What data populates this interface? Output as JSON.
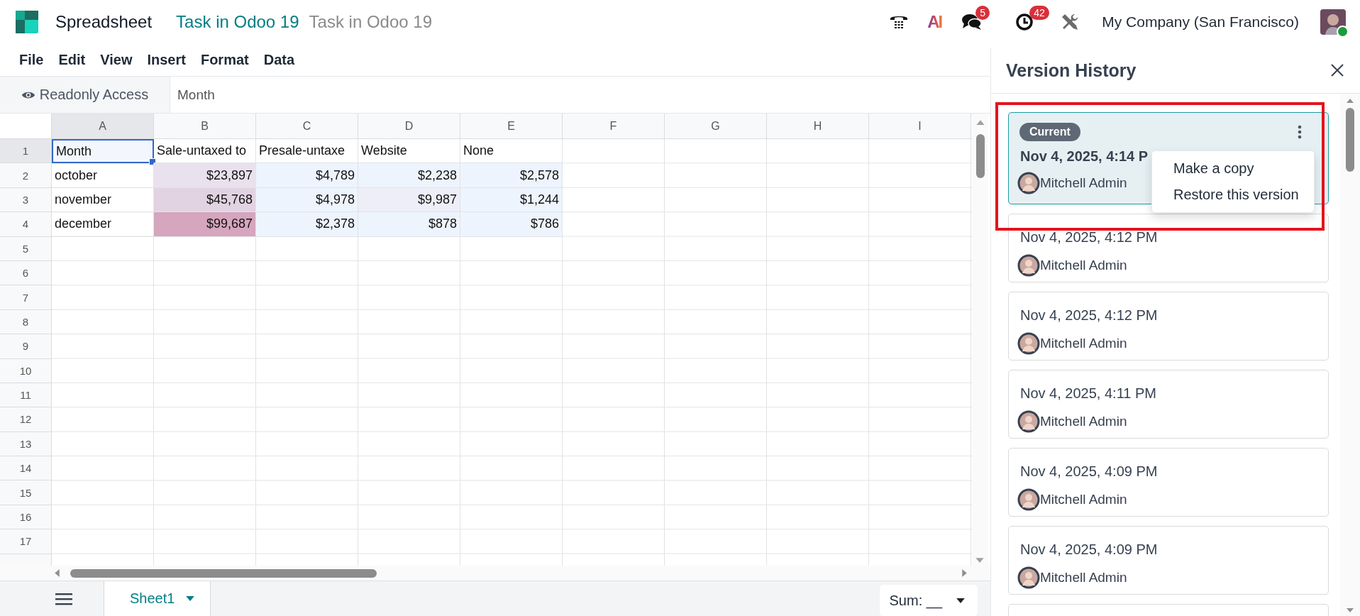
{
  "app": {
    "title": "Spreadsheet",
    "breadcrumbs": [
      {
        "label": "Task in Odoo 19",
        "kind": "link"
      },
      {
        "label": "Task in Odoo 19",
        "kind": "current"
      }
    ]
  },
  "systray": {
    "ai_label": "AI",
    "messages_badge": "5",
    "activities_badge": "42",
    "company": "My Company (San Francisco)"
  },
  "menu": [
    "File",
    "Edit",
    "View",
    "Insert",
    "Format",
    "Data"
  ],
  "access_button": "Readonly Access",
  "formula": "Month",
  "sheet": {
    "column_headers": [
      {
        "label": "A",
        "selected": true
      },
      {
        "label": "B",
        "selected": false
      },
      {
        "label": "C",
        "selected": false
      },
      {
        "label": "D",
        "selected": false
      },
      {
        "label": "E",
        "selected": false
      },
      {
        "label": "F",
        "selected": false
      },
      {
        "label": "G",
        "selected": false
      },
      {
        "label": "H",
        "selected": false
      },
      {
        "label": "I",
        "selected": false
      }
    ],
    "row_headers": [
      {
        "label": "1",
        "selected": true
      },
      {
        "label": "2",
        "selected": false
      },
      {
        "label": "3",
        "selected": false
      },
      {
        "label": "4",
        "selected": false
      },
      {
        "label": "5",
        "selected": false
      },
      {
        "label": "6",
        "selected": false
      },
      {
        "label": "7",
        "selected": false
      },
      {
        "label": "8",
        "selected": false
      },
      {
        "label": "9",
        "selected": false
      },
      {
        "label": "10",
        "selected": false
      },
      {
        "label": "11",
        "selected": false
      },
      {
        "label": "12",
        "selected": false
      },
      {
        "label": "13",
        "selected": false
      },
      {
        "label": "14",
        "selected": false
      },
      {
        "label": "15",
        "selected": false
      },
      {
        "label": "16",
        "selected": false
      },
      {
        "label": "17",
        "selected": false
      }
    ],
    "rows": [
      [
        {
          "text": "Month",
          "kind": "text",
          "selected": true
        },
        {
          "text": "Sale-untaxed to",
          "kind": "text",
          "selected": false
        },
        {
          "text": "Presale-untaxe",
          "kind": "text",
          "selected": false
        },
        {
          "text": "Website",
          "kind": "text",
          "selected": false
        },
        {
          "text": "None",
          "kind": "text",
          "selected": false
        }
      ],
      [
        {
          "text": "october",
          "kind": "text",
          "selected": false
        },
        {
          "text": "$23,897",
          "kind": "number",
          "selected": false,
          "color": "#e9e1ee"
        },
        {
          "text": "$4,789",
          "kind": "number",
          "selected": false,
          "color": "#edf4fd"
        },
        {
          "text": "$2,238",
          "kind": "number",
          "selected": false,
          "color": "#edf4fd"
        },
        {
          "text": "$2,578",
          "kind": "number",
          "selected": false,
          "color": "#edf4fd"
        }
      ],
      [
        {
          "text": "november",
          "kind": "text",
          "selected": false
        },
        {
          "text": "$45,768",
          "kind": "number",
          "selected": false,
          "color": "#e2d3e2"
        },
        {
          "text": "$4,978",
          "kind": "number",
          "selected": false,
          "color": "#edf4fd"
        },
        {
          "text": "$9,987",
          "kind": "number",
          "selected": false,
          "color": "#eeeef8"
        },
        {
          "text": "$1,244",
          "kind": "number",
          "selected": false,
          "color": "#edf4fd"
        }
      ],
      [
        {
          "text": "december",
          "kind": "text",
          "selected": false
        },
        {
          "text": "$99,687",
          "kind": "number",
          "selected": false,
          "color": "#d6a5be"
        },
        {
          "text": "$2,378",
          "kind": "number",
          "selected": false,
          "color": "#edf4fd"
        },
        {
          "text": "$878",
          "kind": "number",
          "selected": false,
          "color": "#edf4fd"
        },
        {
          "text": "$786",
          "kind": "number",
          "selected": false,
          "color": "#edf4fd"
        }
      ]
    ]
  },
  "bottom": {
    "sheets": [
      {
        "label": "Sheet1",
        "selected": true
      }
    ],
    "aggregate": "Sum: __"
  },
  "version_history": {
    "title": "Version History",
    "versions": [
      {
        "badge": "Current",
        "date": "Nov 4, 2025, 4:14 P",
        "author": "Mitchell Admin",
        "selected": true
      },
      {
        "date": "Nov 4, 2025, 4:12 PM",
        "author": "Mitchell Admin",
        "selected": false
      },
      {
        "date": "Nov 4, 2025, 4:12 PM",
        "author": "Mitchell Admin",
        "selected": false
      },
      {
        "date": "Nov 4, 2025, 4:11 PM",
        "author": "Mitchell Admin",
        "selected": false
      },
      {
        "date": "Nov 4, 2025, 4:09 PM",
        "author": "Mitchell Admin",
        "selected": false
      },
      {
        "date": "Nov 4, 2025, 4:09 PM",
        "author": "Mitchell Admin",
        "selected": false
      }
    ],
    "menu": [
      "Make a copy",
      "Restore this version"
    ]
  }
}
